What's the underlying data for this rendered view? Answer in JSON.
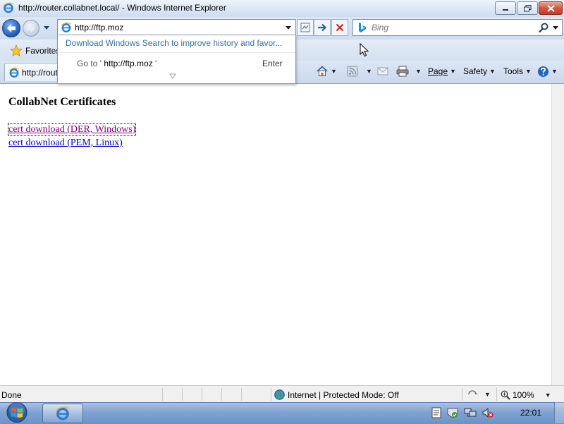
{
  "window": {
    "title": "http://router.collabnet.local/ - Windows Internet Explorer"
  },
  "nav": {
    "address_value": "http://ftp.moz",
    "search_placeholder": "Bing"
  },
  "autocomplete": {
    "windows_search_prompt": "Download Windows Search to improve history and favor...",
    "goto_prefix": "Go to '",
    "goto_url": "http://ftp.moz",
    "goto_suffix": "'",
    "enter_hint": "Enter"
  },
  "favorites_bar": {
    "favorites_label": "Favorites"
  },
  "tab": {
    "label": "http://router.collabnet.local/"
  },
  "command_bar": {
    "page_label": "Page",
    "safety_label": "Safety",
    "tools_label": "Tools"
  },
  "page": {
    "heading": "CollabNet Certificates",
    "links": [
      {
        "label": "cert download (DER, Windows)",
        "visited": true
      },
      {
        "label": "cert download (PEM, Linux)",
        "visited": false
      }
    ]
  },
  "status_bar": {
    "status": "Done",
    "zone": "Internet | Protected Mode: Off",
    "zoom": "100%"
  },
  "taskbar": {
    "clock": "22:01"
  },
  "colors": {
    "visited_link": "#800080",
    "link": "#0000cc",
    "autocomplete_link": "#3a6ea5"
  },
  "icons": [
    "ie-icon",
    "back-arrow-icon",
    "forward-arrow-icon",
    "compat-view-icon",
    "go-arrow-icon",
    "stop-icon",
    "bing-icon",
    "search-icon",
    "favorites-star-icon",
    "home-icon",
    "feeds-icon",
    "read-mail-icon",
    "print-icon",
    "help-icon",
    "globe-icon",
    "zoom-icon",
    "windows-start-icon",
    "action-center-icon",
    "network-icon",
    "volume-muted-icon"
  ]
}
